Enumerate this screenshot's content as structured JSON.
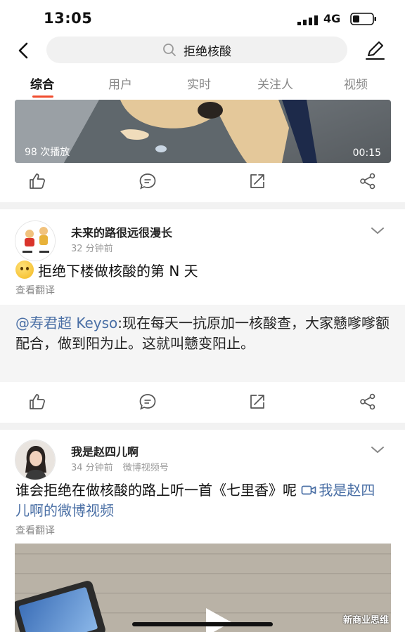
{
  "status_bar": {
    "time": "13:05",
    "network": "4G"
  },
  "search": {
    "query": "拒绝核酸"
  },
  "tabs": [
    {
      "label": "综合",
      "active": true
    },
    {
      "label": "用户",
      "active": false
    },
    {
      "label": "实时",
      "active": false
    },
    {
      "label": "关注人",
      "active": false
    },
    {
      "label": "视频",
      "active": false
    }
  ],
  "video_card_1": {
    "play_count": "98 次播放",
    "duration": "00:15"
  },
  "post_1": {
    "username": "未来的路很远很漫长",
    "time": "32 分钟前",
    "text": "拒绝下楼做核酸的第 N 天",
    "translate": "查看翻译",
    "repost": {
      "mention": "@寿君超 Keyso",
      "text": ":现在每天一抗原加一核酸查，大家戆嗲嗲额配合，做到阳为止。这就叫戆变阳止。"
    }
  },
  "post_2": {
    "username": "我是赵四儿啊",
    "time": "34 分钟前",
    "source": "微博视频号",
    "text": "谁会拒绝在做核酸的路上听一首《七里香》呢",
    "link": "我是赵四儿啊的微博视频",
    "translate": "查看翻译"
  },
  "watermark": "新商业思维",
  "colors": {
    "accent": "#f04d2f",
    "link": "#4a6fa5",
    "muted": "#999999"
  }
}
